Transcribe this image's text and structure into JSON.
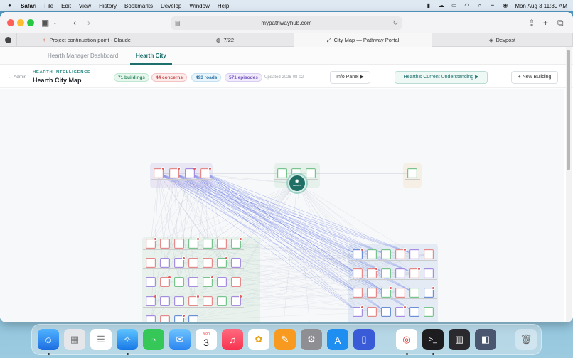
{
  "menubar": {
    "app": "Safari",
    "items": [
      "File",
      "Edit",
      "View",
      "History",
      "Bookmarks",
      "Develop",
      "Window",
      "Help"
    ],
    "clock": "Mon Aug 3  11:30 AM"
  },
  "browser": {
    "url": "mypathwayhub.com",
    "tabs": [
      {
        "label": "Project continuation point - Claude"
      },
      {
        "label": "7/22"
      },
      {
        "label": "City Map — Pathway Portal"
      },
      {
        "label": "Devpost"
      }
    ]
  },
  "app": {
    "nav_tabs": [
      "Hearth Manager Dashboard",
      "Hearth City"
    ],
    "back": "← Admin",
    "eyebrow": "HEARTH INTELLIGENCE",
    "title": "Hearth City Map",
    "stats": {
      "buildings": "71 buildings",
      "concerns": "44 concerns",
      "roads": "493 roads",
      "episodes": "571 episodes"
    },
    "updated": "Updated 2026-08-02",
    "buttons": {
      "info": "Info Panel ▶",
      "understanding": "Hearth's Current Understanding ▶",
      "new_building": "+ New Building"
    },
    "hub_label": "HEARTH"
  },
  "colors": {
    "accent": "#1d6f6b",
    "node_red": "#e58a8a",
    "node_green": "#79c48e",
    "node_purple": "#a58ee0",
    "node_blue": "#6c8fd8",
    "road_blue": "#5b6fe0"
  },
  "dock": [
    "finder-icon",
    "launchpad-icon",
    "reminders-icon",
    "safari-icon",
    "messages-icon",
    "mail-icon",
    "calendar-icon",
    "music-icon",
    "photos-icon",
    "pages-icon",
    "settings-icon",
    "appstore-icon",
    "xcode-icon",
    "chrome-icon",
    "terminal-icon",
    "devtools-icon",
    "cursor-icon",
    "trash-icon"
  ],
  "dock_calendar": {
    "month": "Mon",
    "day": "3"
  }
}
